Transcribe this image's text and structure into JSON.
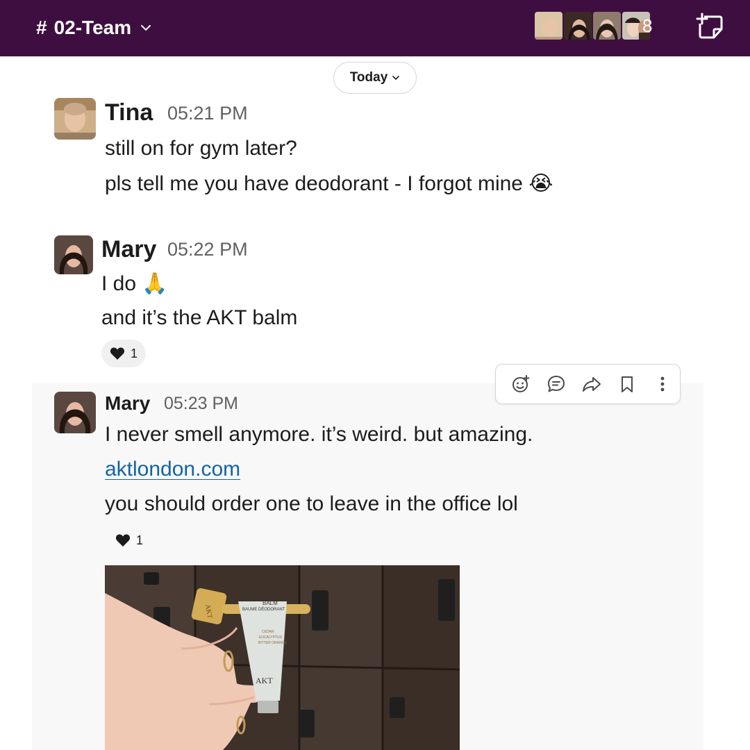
{
  "header": {
    "channel_hash": "#",
    "channel_name": "02-Team",
    "member_count": "8"
  },
  "divider": {
    "label": "Today"
  },
  "messages": [
    {
      "author": "Tina",
      "time": "05:21 PM",
      "lines": [
        "still on for gym later?",
        "pls tell me you have deodorant - I forgot mine"
      ],
      "emoji": "😭"
    },
    {
      "author": "Mary",
      "time": "05:22 PM",
      "lines": [
        "I do",
        "and it’s the AKT balm"
      ],
      "emoji": "🙏",
      "reaction": {
        "icon": "heart-icon",
        "count": "1"
      }
    },
    {
      "author": "Mary",
      "time": "05:23 PM",
      "lines": [
        "I never smell anymore. it’s weird. but amazing.",
        "you should order one to leave in the office lol"
      ],
      "link": "aktlondon.com",
      "reaction": {
        "icon": "heart-icon",
        "count": "1"
      }
    }
  ],
  "photo": {
    "product_top": "BALM",
    "product_sub": "BAUME DÉODORANT",
    "product_notes": [
      "CEDAR",
      "EUCALYPTUS",
      "BITTER ORANGE"
    ],
    "product_brand": "AKT",
    "cap_brand": "AKT"
  },
  "colors": {
    "header_bg": "#3f0e40",
    "link": "#1264a3",
    "hover_bg": "#f8f8f8"
  }
}
